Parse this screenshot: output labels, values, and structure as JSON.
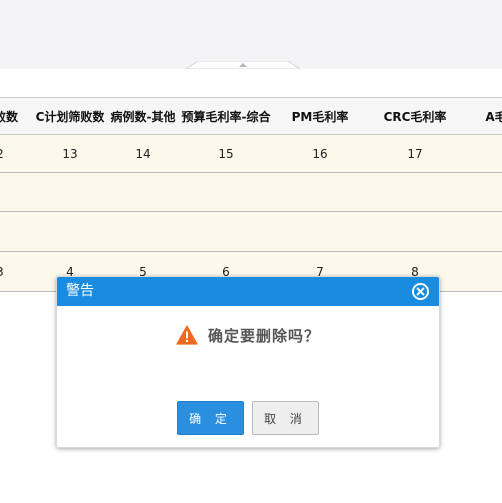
{
  "grid": {
    "columns": [
      "筛败数",
      "C计划筛败数",
      "病例数-其他",
      "预算毛利率-综合",
      "PM毛利率",
      "CRC毛利率",
      "A毛利"
    ],
    "rows": [
      [
        "2",
        "13",
        "14",
        "15",
        "16",
        "17",
        ""
      ],
      [
        "",
        "",
        "",
        "",
        "",
        "",
        ""
      ],
      [
        "",
        "",
        "",
        "",
        "",
        "",
        ""
      ],
      [
        "3",
        "4",
        "5",
        "6",
        "7",
        "8",
        ""
      ]
    ]
  },
  "dialog": {
    "title": "警告",
    "message": "确定要删除吗？",
    "ok_label": "确 定",
    "cancel_label": "取 消",
    "icons": {
      "close": "close-circle-icon",
      "warning": "warning-triangle-icon"
    }
  },
  "colors": {
    "header_blue": "#1a8ce0",
    "ok_button": "#2a8fde",
    "warning_orange": "#f06a1d",
    "row_cream": "#fdf8ec"
  }
}
